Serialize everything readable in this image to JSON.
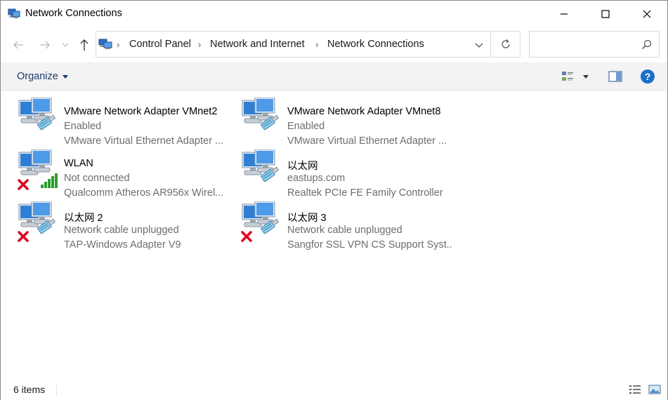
{
  "window": {
    "title": "Network Connections"
  },
  "address": {
    "crumbs": [
      "Control Panel",
      "Network and Internet",
      "Network Connections"
    ]
  },
  "search": {
    "placeholder": "",
    "value": ""
  },
  "toolbar": {
    "organize_label": "Organize"
  },
  "connections": [
    {
      "name": "VMware Network Adapter VMnet2",
      "status": "Enabled",
      "device": "VMware Virtual Ethernet Adapter ...",
      "type": "ethernet",
      "state": "enabled"
    },
    {
      "name": "VMware Network Adapter VMnet8",
      "status": "Enabled",
      "device": "VMware Virtual Ethernet Adapter ...",
      "type": "ethernet",
      "state": "enabled"
    },
    {
      "name": "WLAN",
      "status": "Not connected",
      "device": "Qualcomm Atheros AR956x Wirel...",
      "type": "wifi",
      "state": "disconnected"
    },
    {
      "name": "以太网",
      "status": "eastups.com",
      "device": "Realtek PCIe FE Family Controller",
      "type": "ethernet",
      "state": "enabled"
    },
    {
      "name": "以太网 2",
      "status": "Network cable unplugged",
      "device": "TAP-Windows Adapter V9",
      "type": "ethernet",
      "state": "disconnected"
    },
    {
      "name": "以太网 3",
      "status": "Network cable unplugged",
      "device": "Sangfor SSL VPN CS Support Syst...",
      "type": "ethernet",
      "state": "disconnected"
    }
  ],
  "statusbar": {
    "item_count": "6 items"
  },
  "colors": {
    "accent": "#1e3a6a",
    "help": "#1a6fc7",
    "error": "#e0001b",
    "signal": "#2e9e2e",
    "secondary_text": "#6d6d6d"
  }
}
